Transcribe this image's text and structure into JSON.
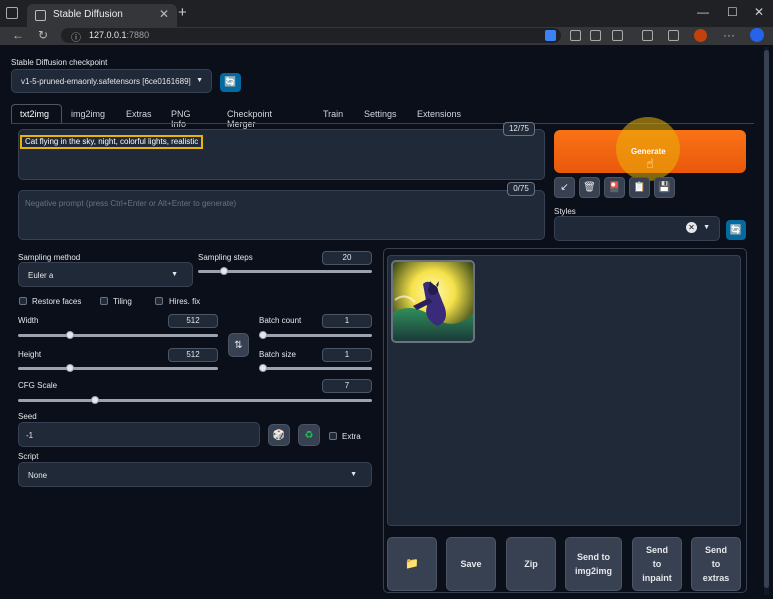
{
  "browser": {
    "tab_title": "Stable Diffusion",
    "url_host": "127.0.0.1",
    "url_port": ":7880"
  },
  "checkpoint": {
    "label": "Stable Diffusion checkpoint",
    "value": "v1-5-pruned-emaonly.safetensors [6ce0161689]"
  },
  "tabs": [
    "txt2img",
    "img2img",
    "Extras",
    "PNG Info",
    "Checkpoint Merger",
    "Train",
    "Settings",
    "Extensions"
  ],
  "prompt": {
    "value": "Cat flying in the sky, night, colorful lights, realistic",
    "counter": "12/75"
  },
  "negative_prompt": {
    "placeholder": "Negative prompt (press Ctrl+Enter or Alt+Enter to generate)",
    "counter": "0/75"
  },
  "generate_label": "Generate",
  "styles_label": "Styles",
  "sampling": {
    "method_label": "Sampling method",
    "method_value": "Euler a",
    "steps_label": "Sampling steps",
    "steps_value": "20",
    "steps_fraction": 0.13
  },
  "options": {
    "restore_faces": "Restore faces",
    "tiling": "Tiling",
    "hires_fix": "Hires. fix"
  },
  "width": {
    "label": "Width",
    "value": "512",
    "fraction": 0.25
  },
  "height": {
    "label": "Height",
    "value": "512",
    "fraction": 0.25
  },
  "batch_count": {
    "label": "Batch count",
    "value": "1",
    "fraction": 0.0
  },
  "batch_size": {
    "label": "Batch size",
    "value": "1",
    "fraction": 0.0
  },
  "cfg": {
    "label": "CFG Scale",
    "value": "7",
    "fraction": 0.21
  },
  "seed": {
    "label": "Seed",
    "value": "-1",
    "extra_label": "Extra"
  },
  "script": {
    "label": "Script",
    "value": "None"
  },
  "output_buttons": {
    "folder_icon": "folder-icon",
    "save": "Save",
    "zip": "Zip",
    "send_img2img": "Send to img2img",
    "send_inpaint": "Send to inpaint",
    "send_extras": "Send to extras"
  },
  "colors": {
    "generate": "#ea580c",
    "highlight": "#eab308",
    "accent": "#2563eb"
  }
}
